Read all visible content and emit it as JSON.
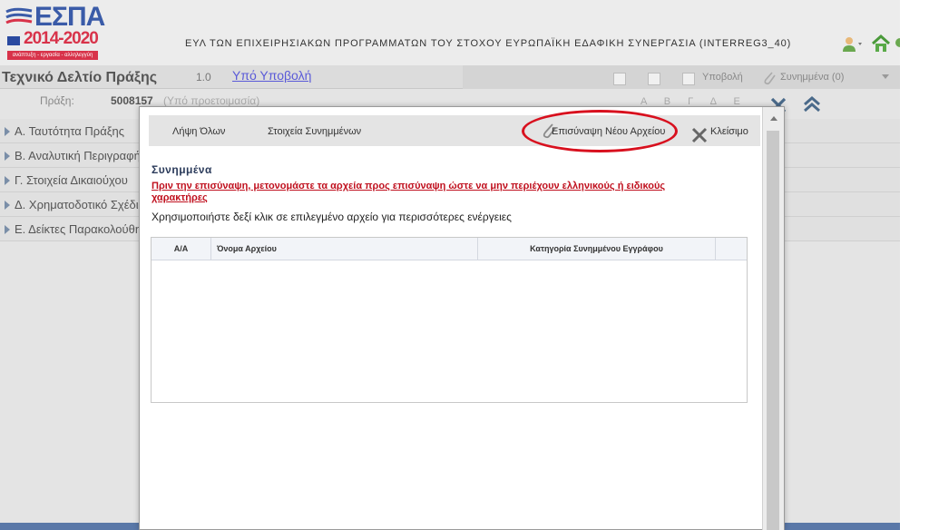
{
  "header": {
    "logo": {
      "brand": "ΕΣΠΑ",
      "years": "2014-2020",
      "tagline": "ανάπτυξη - εργασία - αλληλεγγύη"
    },
    "program_title": "ΕΥΛ ΤΩΝ ΕΠΙΧΕΙΡΗΣΙΑΚΩΝ ΠΡΟΓΡΑΜΜΑΤΩΝ ΤΟΥ ΣΤΟΧΟΥ ΕΥΡΩΠΑΪΚΗ ΕΔΑΦΙΚΗ ΣΥΝΕΡΓΑΣΙΑ (INTERREG3_40)",
    "icons": [
      "user-icon",
      "home-icon"
    ]
  },
  "form": {
    "title": "Τεχνικό Δελτίο Πράξης",
    "version": "1.0",
    "status_link": "Υπό Υποβολή",
    "actions": {
      "submit": "Υποβολή",
      "attachments": "Συνημμένα (0)"
    },
    "praxi_label": "Πράξη:",
    "praxi_code": "5008157",
    "praxi_state": "(Υπό προετοιμασία)",
    "font_letters": "Α Β Γ Δ Ε"
  },
  "sections": [
    {
      "label": "Α. Ταυτότητα Πράξης"
    },
    {
      "label": "Β. Αναλυτική Περιγραφή"
    },
    {
      "label": "Γ. Στοιχεία Δικαιούχου"
    },
    {
      "label": "Δ. Χρηματοδοτικό Σχέδιο"
    },
    {
      "label": "Ε. Δείκτες Παρακολούθησης"
    }
  ],
  "modal": {
    "toolbar": {
      "download_all": "Λήψη Όλων",
      "attachment_details": "Στοιχεία Συνημμένων",
      "attach_new": "Επισύναψη Νέου Αρχείου",
      "close": "Κλείσιμο"
    },
    "section_title": "Συνημμένα",
    "warning": "Πριν την επισύναψη, μετονομάστε τα αρχεία προς επισύναψη ώστε να μην περιέχουν ελληνικούς ή ειδικούς χαρακτήρες",
    "hint": "Χρησιμοποιήστε δεξί κλικ σε επιλεγμένο αρχείο για περισσότερες ενέργειες",
    "table": {
      "columns": [
        "Α/Α",
        "Όνομα Αρχείου",
        "Κατηγορία Συνημμένου Εγγράφου",
        ""
      ],
      "rows": []
    },
    "highlight_color": "#d8101e"
  },
  "colors": {
    "brand_blue": "#3a5ba8",
    "brand_red": "#d8334a",
    "link": "#5a5ad8",
    "warning": "#c0101e"
  }
}
